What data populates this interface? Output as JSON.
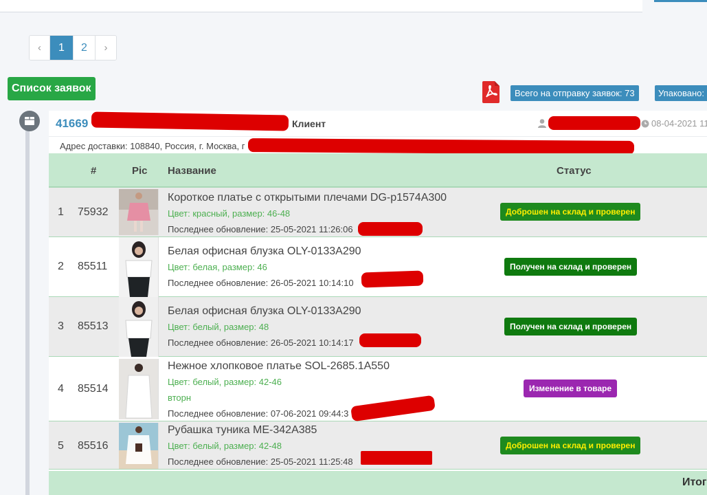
{
  "pagination": {
    "prev": "‹",
    "pages": [
      "1",
      "2"
    ],
    "next": "›",
    "active": "1"
  },
  "list_title": "Список заявок",
  "badges": {
    "total": "Всего на отправку заявок: 73",
    "packed": "Упаковано:"
  },
  "order": {
    "id": "41669",
    "client_label": "Клиент",
    "date": "08-04-2021 11",
    "address": "Адрес доставки: 108840, Россия, г. Москва, г"
  },
  "table": {
    "headers": {
      "hash": "#",
      "pic": "Pic",
      "name": "Название",
      "status": "Статус"
    },
    "rows": [
      {
        "n": "1",
        "id": "75932",
        "name": "Короткое платье с открытыми плечами DG-p1574A300",
        "attr": "Цвет: красный, размер: 46-48",
        "note": "",
        "updated": "Последнее обновление: 25-05-2021 11:26:06",
        "status": "Доброшен на склад и проверен",
        "status_style": "green-yellow"
      },
      {
        "n": "2",
        "id": "85511",
        "name": "Белая офисная блузка OLY-0133A290",
        "attr": "Цвет: белая, размер: 46",
        "note": "",
        "updated": "Последнее обновление: 26-05-2021 10:14:10",
        "status": "Получен на склад и проверен",
        "status_style": "green-yellow"
      },
      {
        "n": "3",
        "id": "85513",
        "name": "Белая офисная блузка OLY-0133A290",
        "attr": "Цвет: белый, размер: 48",
        "note": "",
        "updated": "Последнее обновление: 26-05-2021 10:14:17",
        "status": "Получен на склад и проверен",
        "status_style": "green-yellow"
      },
      {
        "n": "4",
        "id": "85514",
        "name": "Нежное хлопковое платье SOL-2685.1A550",
        "attr": "Цвет: белый, размер: 42-46",
        "note": "вторн",
        "updated": "Последнее обновление: 07-06-2021 09:44:3",
        "status": "Изменение в товаре",
        "status_style": "purple"
      },
      {
        "n": "5",
        "id": "85516",
        "name": "Рубашка туника ME-342A385",
        "attr": "Цвет: белый, размер: 42-48",
        "note": "",
        "updated": "Последнее обновление: 25-05-2021 11:25:48",
        "status": "Доброшен на склад и проверен",
        "status_style": "green-yellow"
      }
    ],
    "footer_label": "Итог"
  },
  "colors": {
    "primary": "#3c8dbc",
    "success": "#28a745",
    "table_head": "#c5e8cf",
    "redaction": "#dd0000",
    "status_purple": "#9b27b0"
  }
}
